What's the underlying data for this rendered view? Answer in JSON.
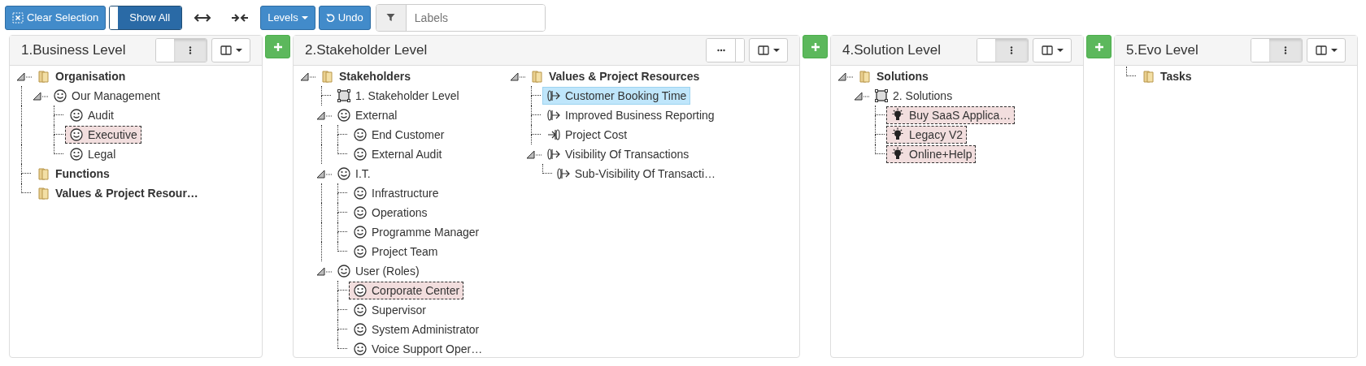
{
  "toolbar": {
    "clear_selection": "Clear Selection",
    "show_all": {
      "label": "Show All",
      "on": true
    },
    "levels": "Levels",
    "undo": "Undo",
    "filter": {
      "placeholder": "Labels"
    }
  },
  "panels": [
    {
      "title": "1.Business Level",
      "toggle_on": false,
      "columns": [
        {
          "nodes": [
            {
              "label": "Organisation",
              "kind": "folder",
              "selected": false,
              "marked": false,
              "expanded": true,
              "children": [
                {
                  "label": "Our Management",
                  "kind": "person",
                  "selected": false,
                  "marked": false,
                  "expanded": true,
                  "children": [
                    {
                      "label": "Audit",
                      "kind": "person",
                      "selected": false,
                      "marked": false
                    },
                    {
                      "label": "Executive",
                      "kind": "person",
                      "selected": false,
                      "marked": true
                    },
                    {
                      "label": "Legal",
                      "kind": "person",
                      "selected": false,
                      "marked": false
                    }
                  ]
                }
              ]
            },
            {
              "label": "Functions",
              "kind": "folder",
              "selected": false,
              "marked": false
            },
            {
              "label": "Values & Project Resour…",
              "kind": "folder",
              "selected": false,
              "marked": false
            }
          ]
        }
      ]
    },
    {
      "title": "2.Stakeholder Level",
      "toggle_on": true,
      "columns": [
        {
          "nodes": [
            {
              "label": "Stakeholders",
              "kind": "folder",
              "selected": false,
              "marked": false,
              "expanded": true,
              "children": [
                {
                  "label": "1. Stakeholder Level",
                  "kind": "group",
                  "selected": false,
                  "marked": false
                },
                {
                  "label": "External",
                  "kind": "person",
                  "selected": false,
                  "marked": false,
                  "expanded": true,
                  "children": [
                    {
                      "label": "End Customer",
                      "kind": "person",
                      "selected": false,
                      "marked": false
                    },
                    {
                      "label": "External Audit",
                      "kind": "person",
                      "selected": false,
                      "marked": false
                    }
                  ]
                },
                {
                  "label": "I.T.",
                  "kind": "person",
                  "selected": false,
                  "marked": false,
                  "expanded": true,
                  "children": [
                    {
                      "label": "Infrastructure",
                      "kind": "person",
                      "selected": false,
                      "marked": false
                    },
                    {
                      "label": "Operations",
                      "kind": "person",
                      "selected": false,
                      "marked": false
                    },
                    {
                      "label": "Programme Manager",
                      "kind": "person",
                      "selected": false,
                      "marked": false
                    },
                    {
                      "label": "Project Team",
                      "kind": "person",
                      "selected": false,
                      "marked": false
                    }
                  ]
                },
                {
                  "label": "User (Roles)",
                  "kind": "person",
                  "selected": false,
                  "marked": false,
                  "expanded": true,
                  "children": [
                    {
                      "label": "Corporate Center",
                      "kind": "person",
                      "selected": false,
                      "marked": true
                    },
                    {
                      "label": "Supervisor",
                      "kind": "person",
                      "selected": false,
                      "marked": false
                    },
                    {
                      "label": "System Administrator",
                      "kind": "person",
                      "selected": false,
                      "marked": false
                    },
                    {
                      "label": "Voice Support Oper…",
                      "kind": "person",
                      "selected": false,
                      "marked": false
                    }
                  ]
                }
              ]
            }
          ]
        },
        {
          "nodes": [
            {
              "label": "Values & Project Resources",
              "kind": "folder",
              "selected": false,
              "marked": false,
              "expanded": true,
              "children": [
                {
                  "label": "Customer Booking Time",
                  "kind": "value",
                  "selected": true,
                  "marked": false
                },
                {
                  "label": "Improved Business Reporting",
                  "kind": "value",
                  "selected": false,
                  "marked": false
                },
                {
                  "label": "Project Cost",
                  "kind": "cost",
                  "selected": false,
                  "marked": false
                },
                {
                  "label": "Visibility Of Transactions",
                  "kind": "value",
                  "selected": false,
                  "marked": false,
                  "expanded": true,
                  "children": [
                    {
                      "label": "Sub-Visibility Of Transacti…",
                      "kind": "value",
                      "selected": false,
                      "marked": false
                    }
                  ]
                }
              ]
            }
          ]
        }
      ]
    },
    {
      "title": "4.Solution Level",
      "toggle_on": false,
      "columns": [
        {
          "nodes": [
            {
              "label": "Solutions",
              "kind": "folder",
              "selected": false,
              "marked": false,
              "expanded": true,
              "children": [
                {
                  "label": "2. Solutions",
                  "kind": "group",
                  "selected": false,
                  "marked": false,
                  "expanded": true,
                  "children": [
                    {
                      "label": "Buy SaaS Applica…",
                      "kind": "idea",
                      "selected": false,
                      "marked": true
                    },
                    {
                      "label": "Legacy V2",
                      "kind": "idea",
                      "selected": false,
                      "marked": true
                    },
                    {
                      "label": "Online+Help",
                      "kind": "idea",
                      "selected": false,
                      "marked": true
                    }
                  ]
                }
              ]
            }
          ]
        }
      ]
    },
    {
      "title": "5.Evo Level",
      "toggle_on": false,
      "columns": [
        {
          "nodes": [
            {
              "label": "Tasks",
              "kind": "folder",
              "selected": false,
              "marked": false
            }
          ]
        }
      ]
    }
  ]
}
